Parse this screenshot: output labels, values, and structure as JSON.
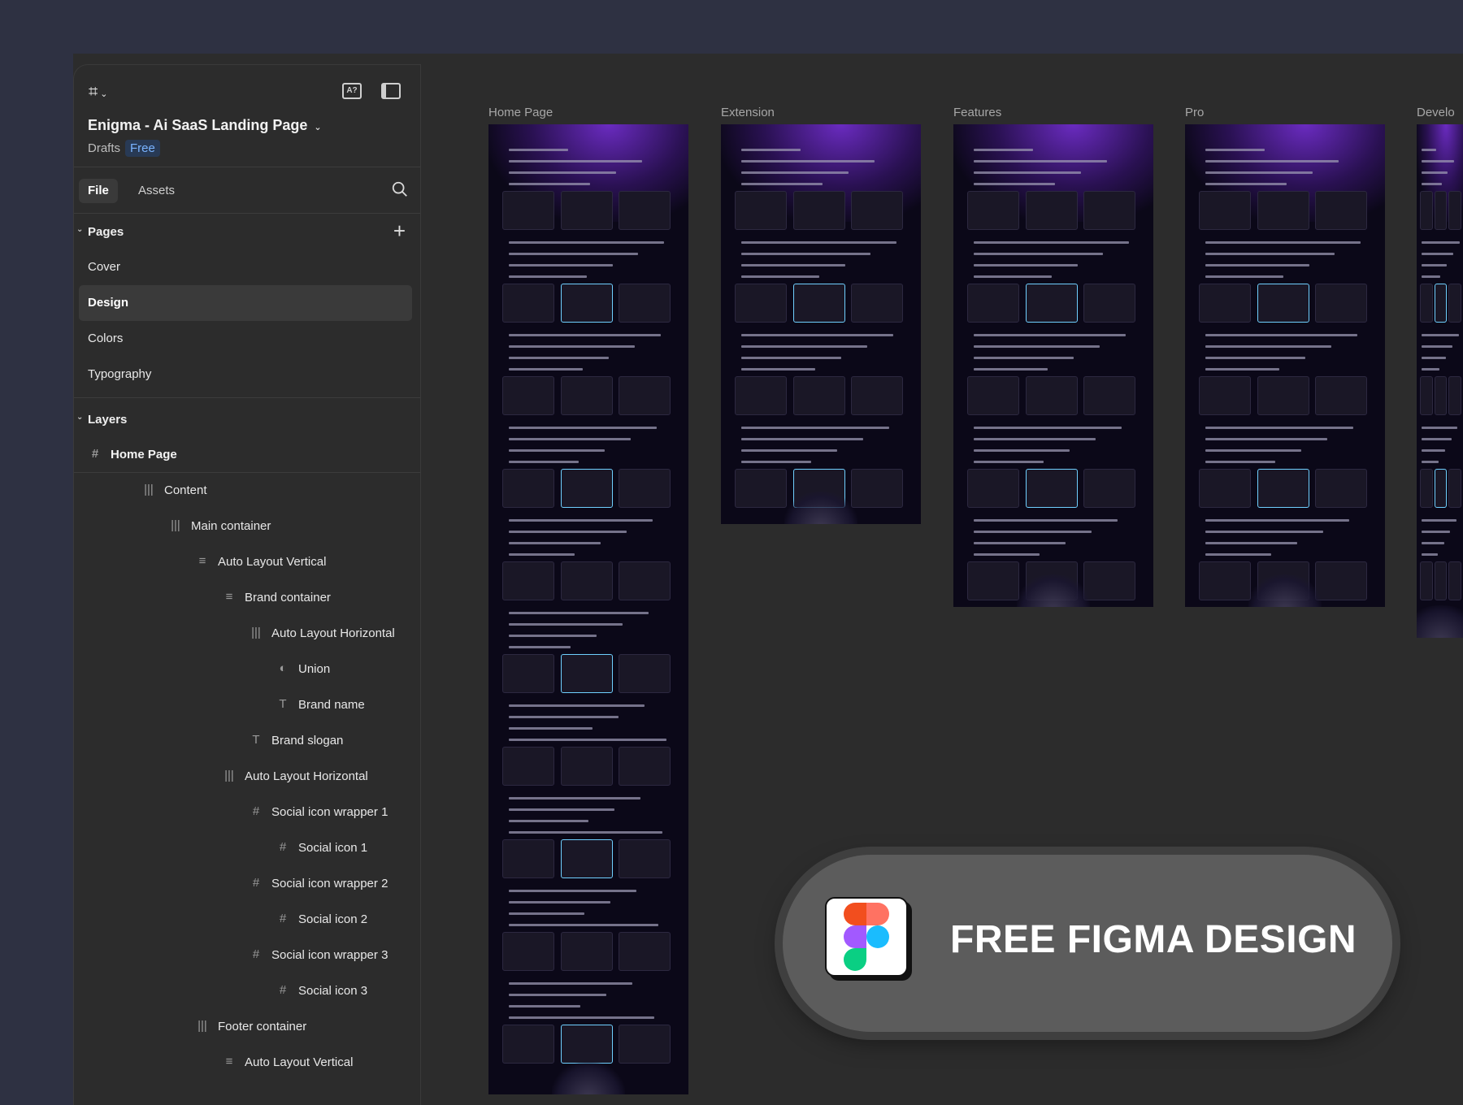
{
  "file": {
    "title": "Enigma - Ai SaaS Landing Page",
    "location": "Drafts",
    "plan_badge": "Free"
  },
  "tabs": {
    "file": "File",
    "assets": "Assets"
  },
  "pages": {
    "heading": "Pages",
    "items": [
      {
        "label": "Cover"
      },
      {
        "label": "Design",
        "selected": true
      },
      {
        "label": "Colors"
      },
      {
        "label": "Typography"
      }
    ]
  },
  "layers": {
    "heading": "Layers",
    "items": [
      {
        "label": "Home Page",
        "icon": "frame-icon",
        "depth": 0
      },
      {
        "label": "Content",
        "icon": "auto-layout-horizontal-icon",
        "depth": 2
      },
      {
        "label": "Main container",
        "icon": "auto-layout-horizontal-icon",
        "depth": 3
      },
      {
        "label": "Auto Layout Vertical",
        "icon": "auto-layout-vertical-icon",
        "depth": 4
      },
      {
        "label": "Brand container",
        "icon": "auto-layout-vertical-icon",
        "depth": 5
      },
      {
        "label": "Auto Layout Horizontal",
        "icon": "auto-layout-horizontal-icon",
        "depth": 6
      },
      {
        "label": "Union",
        "icon": "boolean-union-icon",
        "depth": 7
      },
      {
        "label": "Brand name",
        "icon": "text-icon",
        "depth": 7
      },
      {
        "label": "Brand slogan",
        "icon": "text-icon",
        "depth": 6
      },
      {
        "label": "Auto Layout Horizontal",
        "icon": "auto-layout-horizontal-icon",
        "depth": 5
      },
      {
        "label": "Social icon wrapper 1",
        "icon": "frame-icon",
        "depth": 6
      },
      {
        "label": "Social icon 1",
        "icon": "frame-icon",
        "depth": 7
      },
      {
        "label": "Social icon wrapper 2",
        "icon": "frame-icon",
        "depth": 6
      },
      {
        "label": "Social icon 2",
        "icon": "frame-icon",
        "depth": 7
      },
      {
        "label": "Social icon wrapper 3",
        "icon": "frame-icon",
        "depth": 6
      },
      {
        "label": "Social icon 3",
        "icon": "frame-icon",
        "depth": 7
      },
      {
        "label": "Footer container",
        "icon": "auto-layout-horizontal-icon",
        "depth": 4
      },
      {
        "label": "Auto Layout Vertical",
        "icon": "auto-layout-vertical-icon",
        "depth": 5
      }
    ]
  },
  "canvas": {
    "frames": [
      {
        "label": "Home Page"
      },
      {
        "label": "Extension"
      },
      {
        "label": "Features"
      },
      {
        "label": "Pro"
      },
      {
        "label": "Develo"
      }
    ]
  },
  "promo": {
    "text": "FREE FIGMA DESIGN"
  },
  "colors": {
    "background": "#2e3142",
    "panel": "#2c2c2c",
    "badge_text": "#7ab4ff",
    "frame_bg": "#0b0818",
    "accent_purple": "#6a2bc0"
  }
}
